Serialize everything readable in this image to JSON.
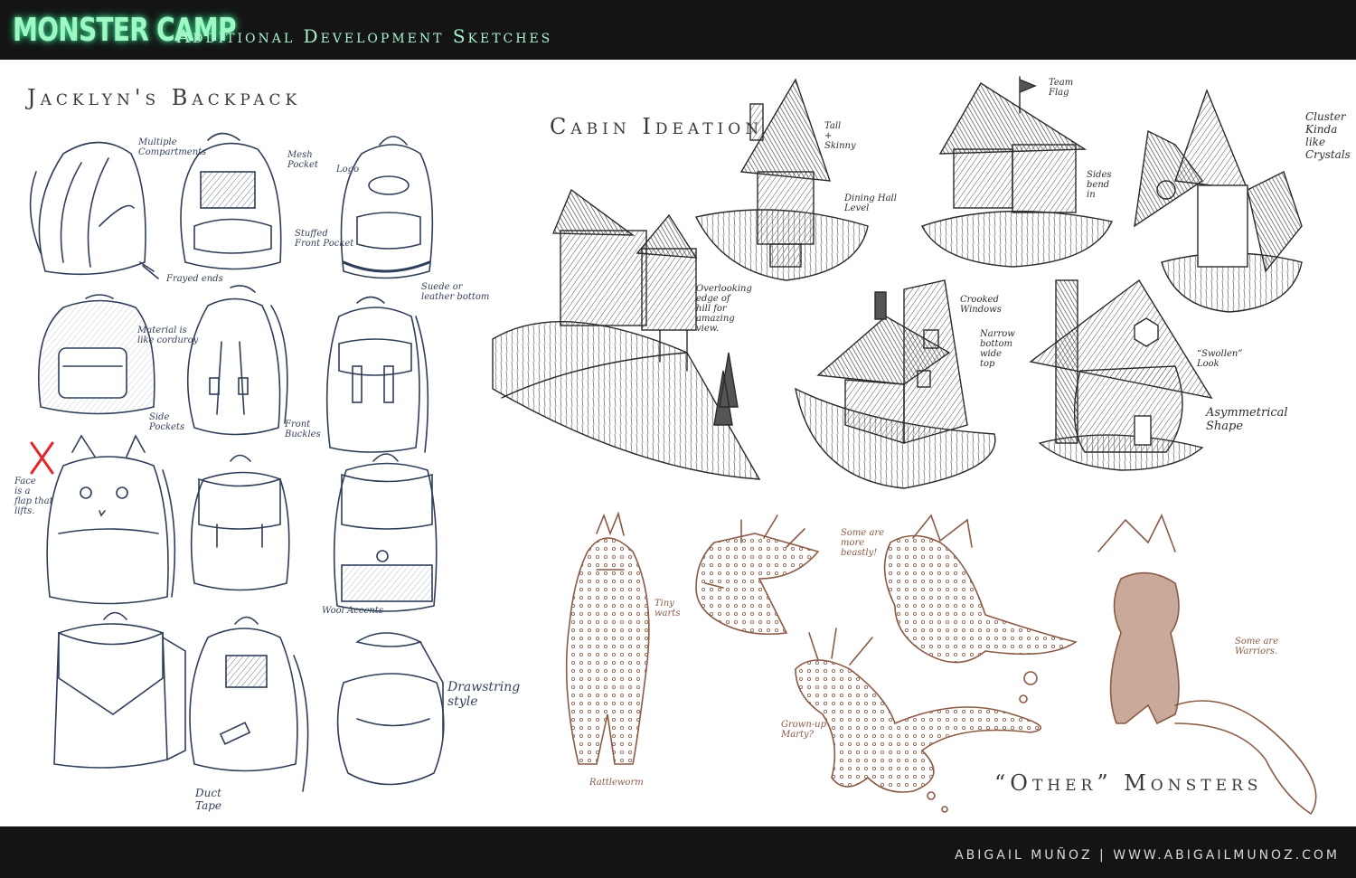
{
  "header": {
    "logo": "MONSTER CAMP",
    "subtitle": "-Additional Development Sketches"
  },
  "sections": {
    "backpack": "Jacklyn's Backpack",
    "cabin": "Cabin Ideation",
    "monsters": "“Other” Monsters"
  },
  "backpack_notes": [
    "Multiple\nCompartments",
    "Mesh\nPocket",
    "Logo",
    "Stuffed\nFront Pocket",
    "Frayed ends",
    "Suede or\nleather bottom",
    "Material is\nlike corduroy",
    "Side\nPockets",
    "Front\nBuckles",
    "Face\nis a\nflap that\nlifts.",
    "Wool Accents",
    "Drawstring\nstyle",
    "Duct\nTape"
  ],
  "cabin_notes": [
    "Tall\n+\nSkinny",
    "Dining Hall\nLevel",
    "Team\nFlag",
    "Sides\nbend\nin",
    "Cluster\nKinda\nlike\nCrystals",
    "Overlooking\nedge of\nhill for\namazing\nview.",
    "Crooked\nWindows",
    "Narrow\nbottom\nwide\ntop",
    "“Swollen”\nLook",
    "Asymmetrical\nShape"
  ],
  "monster_notes": [
    "Tiny\nwarts",
    "Some are\nmore\nbeastly!",
    "Some are\nWarriors.",
    "Grown-up\nMarty?",
    "Rattleworm"
  ],
  "footer": {
    "credit": "ABIGAIL MUÑOZ | WWW.ABIGAILMUNOZ.COM"
  },
  "colors": {
    "frame": "#141414",
    "logo_glow": "#9ff7c4",
    "backpack_ink": "#2f3e58",
    "cabin_ink": "#2a2a2a",
    "monster_ink": "#8b5a45"
  }
}
